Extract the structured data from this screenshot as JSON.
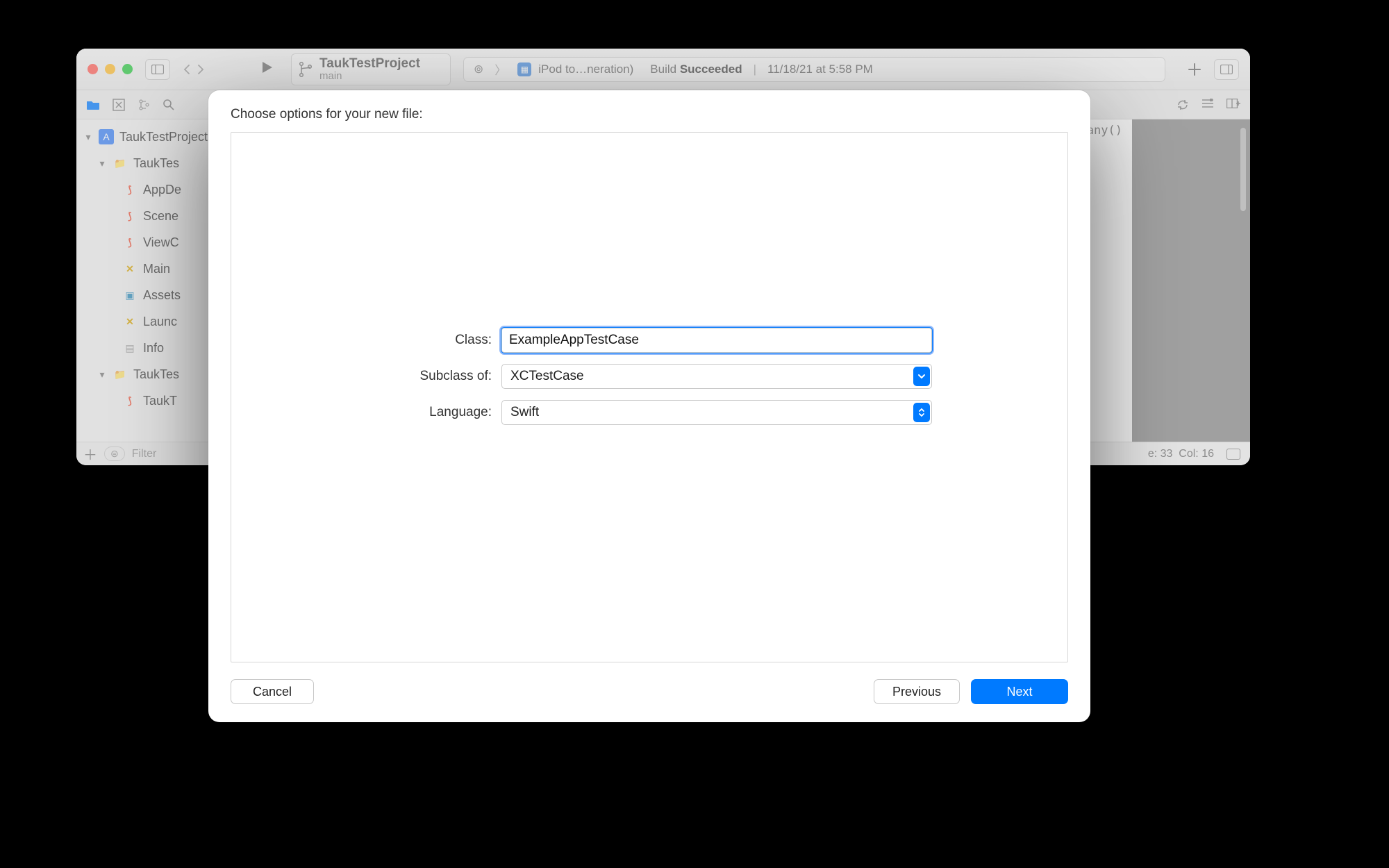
{
  "colors": {
    "accent": "#007aff",
    "traffic": {
      "red": "#ff5f57",
      "yellow": "#febc2e",
      "green": "#28c840"
    },
    "swift": "#f05138"
  },
  "toolbar": {
    "scheme_title": "TaukTestProject",
    "scheme_branch": "main",
    "device_label": "iPod to…neration)",
    "build_prefix": "Build ",
    "build_status": "Succeeded",
    "build_timestamp": "11/18/21 at 5:58 PM"
  },
  "navigator": {
    "project_name": "TaukTestProject",
    "items": [
      {
        "name": "TaukTes",
        "kind": "folder",
        "expanded": true
      },
      {
        "name": "AppDe",
        "kind": "swift"
      },
      {
        "name": "Scene",
        "kind": "swift"
      },
      {
        "name": "ViewC",
        "kind": "swift"
      },
      {
        "name": "Main",
        "kind": "xib"
      },
      {
        "name": "Assets",
        "kind": "assets"
      },
      {
        "name": "Launc",
        "kind": "xib"
      },
      {
        "name": "Info",
        "kind": "plist"
      },
      {
        "name": "TaukTes",
        "kind": "folder",
        "expanded": true
      },
      {
        "name": "TaukT",
        "kind": "swift"
      }
    ],
    "filter_placeholder": "Filter"
  },
  "editor": {
    "snippet": "ompany()",
    "cursor_line": "33",
    "cursor_col": "16",
    "line_label": "e: ",
    "col_label": "Col: "
  },
  "sheet": {
    "title": "Choose options for your new file:",
    "class_label": "Class:",
    "class_value": "ExampleAppTestCase",
    "subclass_label": "Subclass of:",
    "subclass_value": "XCTestCase",
    "language_label": "Language:",
    "language_value": "Swift",
    "cancel": "Cancel",
    "previous": "Previous",
    "next": "Next"
  }
}
